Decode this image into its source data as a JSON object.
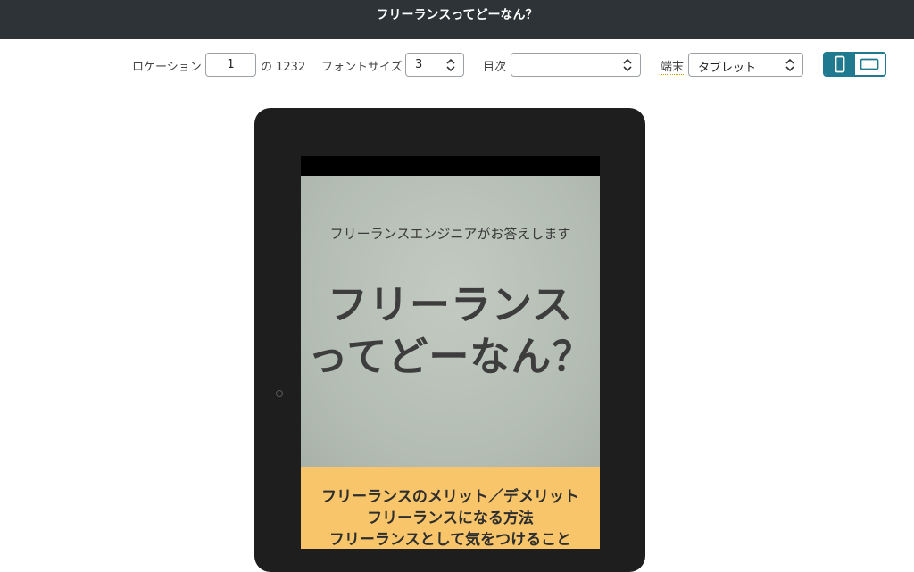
{
  "window": {
    "title": "フリーランスってどーなん？"
  },
  "toolbar": {
    "location_label": "ロケーション",
    "location_value": "1",
    "location_total": "の 1232",
    "font_size_label": "フォントサイズ",
    "font_size_value": "3",
    "toc_label": "目次",
    "toc_value": "",
    "device_label": "端末",
    "device_value": "タブレット",
    "orientation": {
      "selected": "portrait",
      "options": [
        "portrait",
        "landscape"
      ]
    }
  },
  "book_cover": {
    "subtitle": "フリーランスエンジニアがお答えします",
    "title_line1": "フリーランス",
    "title_line2": "ってどーなん？",
    "toc_lines": [
      "フリーランスのメリット／デメリット",
      "フリーランスになる方法",
      "フリーランスとして気をつけること"
    ]
  },
  "colors": {
    "titlebar_bg": "#2d3336",
    "accent": "#1f7a8f",
    "cover_green": "#b8c0b7",
    "cover_band": "#f8c56a",
    "tablet_frame": "#1e1e1e"
  },
  "icons": {
    "spinner": "up-down-chevron-icon",
    "portrait": "portrait-orientation-icon",
    "landscape": "landscape-orientation-icon"
  }
}
